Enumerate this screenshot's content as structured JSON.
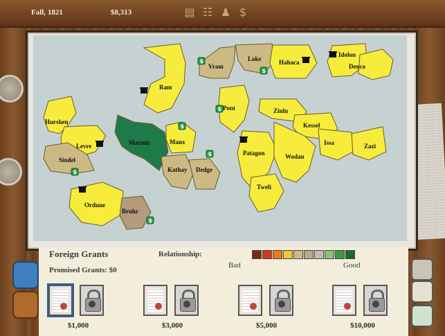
{
  "header": {
    "date": "Fall, 1821",
    "treasury": "$8,313",
    "icons": [
      "parliament-icon",
      "temple-icon",
      "statue-icon",
      "dollar-icon"
    ]
  },
  "map": {
    "countries": [
      {
        "name": "Ram"
      },
      {
        "name": "Vram"
      },
      {
        "name": "Loke"
      },
      {
        "name": "Hahaca"
      },
      {
        "name": "Idolon"
      },
      {
        "name": "Denco"
      },
      {
        "name": "Hurshen"
      },
      {
        "name": "Levre"
      },
      {
        "name": "Marmir"
      },
      {
        "name": "Manx"
      },
      {
        "name": "Pont"
      },
      {
        "name": "Zinlu"
      },
      {
        "name": "Kessel"
      },
      {
        "name": "Issa"
      },
      {
        "name": "Zazi"
      },
      {
        "name": "Sindel"
      },
      {
        "name": "Kathay"
      },
      {
        "name": "Dedge"
      },
      {
        "name": "Patagon"
      },
      {
        "name": "Wodan"
      },
      {
        "name": "Tweli"
      },
      {
        "name": "Ordune"
      },
      {
        "name": "Bruhr"
      }
    ]
  },
  "grants": {
    "title": "Foreign Grants",
    "promised": "Promised Grants: $0",
    "relationship_label": "Relationship:",
    "bad_label": "Bad",
    "good_label": "Good",
    "relationship_colors": [
      "#7a2a12",
      "#d13a1a",
      "#e8791c",
      "#f0c830",
      "#cdb88a",
      "#b7a98a",
      "#bdbdb8",
      "#8fbf70",
      "#3f9a3f",
      "#1f6a2a"
    ],
    "options": [
      {
        "amount": "$1,000"
      },
      {
        "amount": "$3,000"
      },
      {
        "amount": "$5,000"
      },
      {
        "amount": "$10,000"
      }
    ]
  }
}
